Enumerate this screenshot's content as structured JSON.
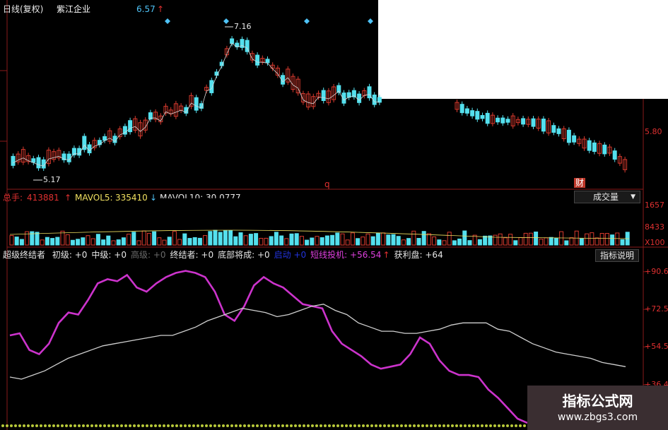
{
  "header": {
    "chart_mode": "日线(复权)",
    "stock_name": "紫江企业",
    "last_price": "6.57",
    "last_arrow": "↑"
  },
  "price_panel": {
    "high_annotation": "7.16",
    "low_annotation": "5.17",
    "axis_label": "5.80",
    "marker_q": "q",
    "marker_cai": "财"
  },
  "volume_panel": {
    "total_label": "总手:",
    "total_value": "413881",
    "total_arrow": "↑",
    "mavol5_label": "MAVOL5:",
    "mavol5_value": "335410",
    "mavol5_arrow": "↓",
    "mavol10_label_partial": "MAVOL10: 30.0777",
    "dropdown_label": "成交量",
    "dropdown_caret": "▼",
    "axis_top": "1657",
    "axis_mid": "8433",
    "axis_unit": "X100"
  },
  "indicator_panel": {
    "name": "超级终结者",
    "fields": [
      {
        "label": "初级:",
        "value": "+0",
        "color": "#e8e8e8"
      },
      {
        "label": "中级:",
        "value": "+0",
        "color": "#e8e8e8"
      },
      {
        "label": "高级:",
        "value": "+0",
        "color": "#6a6a6a"
      },
      {
        "label": "终结者:",
        "value": "+0",
        "color": "#e8e8e8"
      },
      {
        "label": "底部将成:",
        "value": "+0",
        "color": "#e8e8e8"
      },
      {
        "label": "启动",
        "value": "+0",
        "color": "#2233dd"
      },
      {
        "label": "短线投机:",
        "value": "+56.54",
        "color": "#e040e0"
      },
      {
        "label": "获利盘:",
        "value": "+64",
        "color": "#e8e8e8"
      }
    ],
    "short_arrow": "↑",
    "help_button": "指标说明",
    "axis_labels": [
      "+90.6",
      "+72.5",
      "+54.5",
      "+36.4"
    ]
  },
  "watermark": {
    "title": "指标公式网",
    "url": "www.zbgs3.com"
  },
  "colors": {
    "up": "#d83a2e",
    "down": "#54e0ee",
    "speculation_line": "#cc33cc",
    "profit_line": "#cfcfcf",
    "axis_text": "#e03030"
  },
  "chart_data": [
    {
      "type": "line",
      "title": "超级终结者",
      "ylim": [
        18.3,
        99
      ],
      "yticks": [
        90.6,
        72.5,
        54.5,
        36.4
      ],
      "series": [
        {
          "name": "短线投机",
          "values": [
            60,
            61,
            53,
            51,
            56,
            66,
            71,
            70,
            77,
            85,
            87,
            86,
            89,
            83,
            81,
            85,
            88,
            90,
            91,
            90,
            88,
            81,
            70,
            67,
            74,
            84,
            88,
            85,
            83,
            79,
            75,
            74,
            73,
            62,
            56,
            53,
            50,
            46,
            44,
            45,
            46,
            51,
            59,
            56,
            48,
            43,
            41,
            41,
            40,
            34,
            30,
            25,
            20,
            18
          ]
        },
        {
          "name": "获利盘",
          "values": [
            40,
            39,
            41,
            43,
            46,
            49,
            51,
            53,
            55,
            56,
            57,
            58,
            59,
            60,
            60,
            62,
            64,
            67,
            69,
            71,
            73,
            72,
            71,
            69,
            70,
            72,
            74,
            75,
            72,
            70,
            66,
            64,
            62,
            62,
            61,
            61,
            62,
            63,
            65,
            66,
            66,
            66,
            63,
            62,
            59,
            56,
            54,
            52,
            51,
            50,
            49,
            47,
            46,
            45
          ]
        }
      ]
    }
  ]
}
